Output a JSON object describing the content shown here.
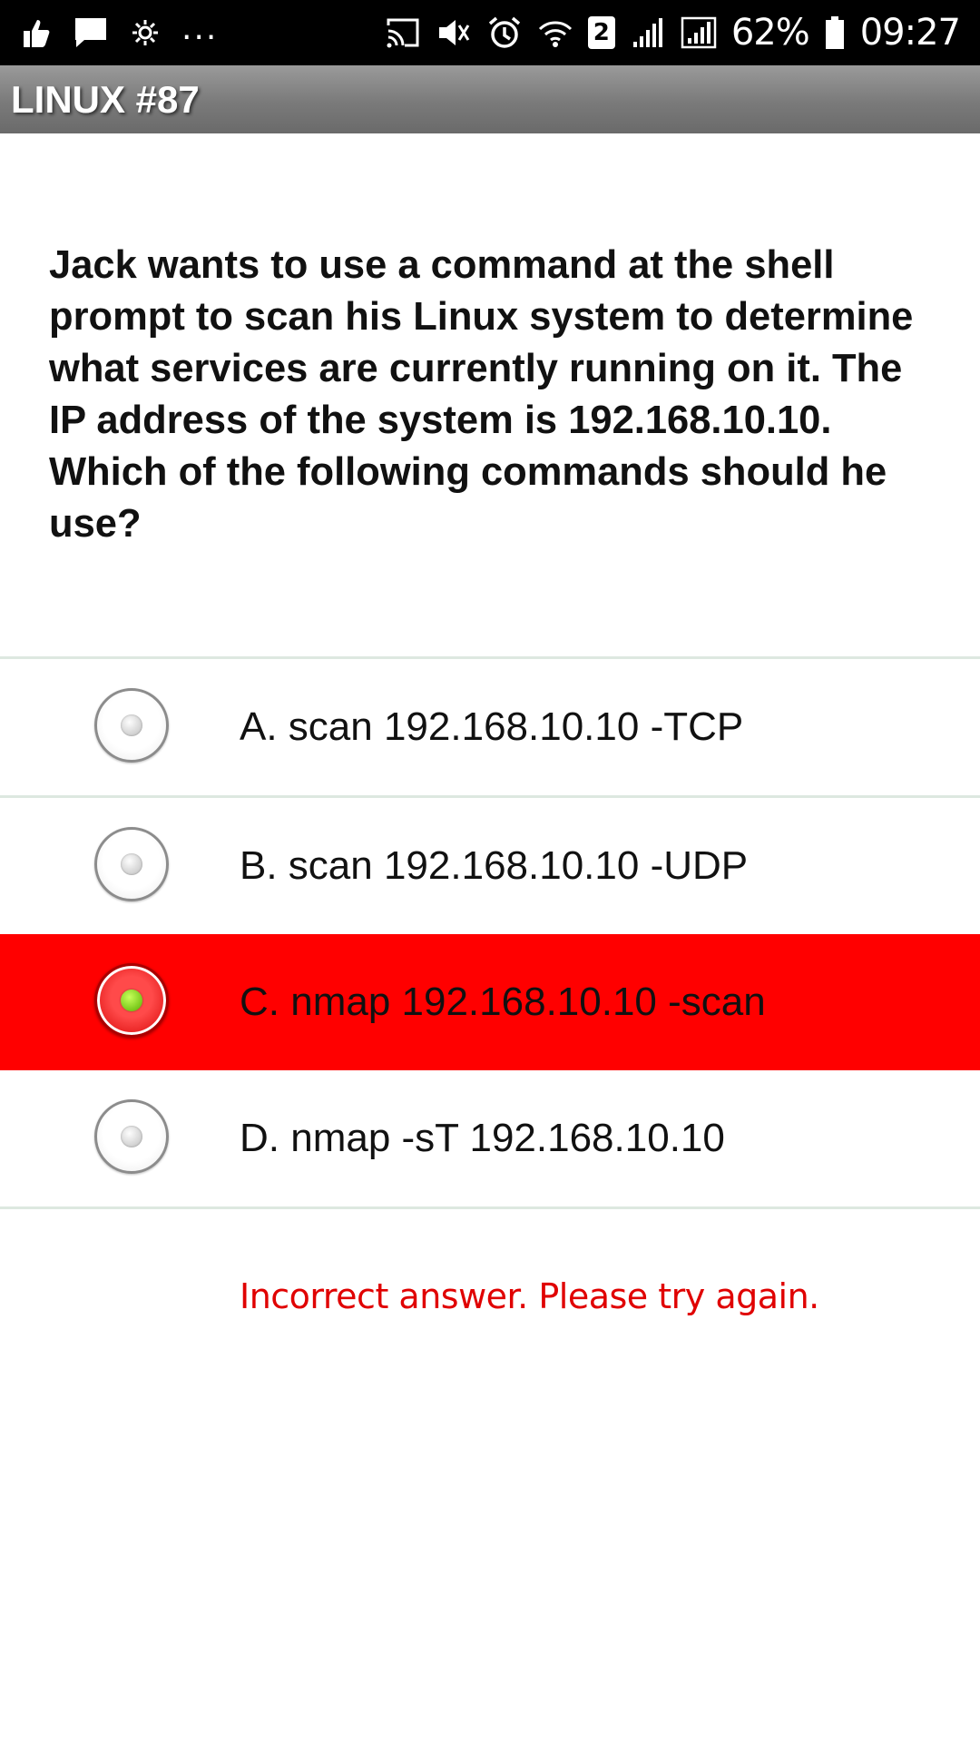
{
  "status_bar": {
    "left_icons": [
      "thumbs-up-icon",
      "chat-bubble-icon",
      "blossom-icon",
      "more-notifications-icon"
    ],
    "ellipsis": "...",
    "sim_badge": "2",
    "battery": "62%",
    "time": "09:27",
    "right_icons": [
      "cast-icon",
      "mute-icon",
      "alarm-icon",
      "wifi-icon",
      "signal-icon",
      "signal-icon",
      "battery-icon"
    ]
  },
  "header": {
    "title": "LINUX #87"
  },
  "quiz": {
    "question": "Jack wants to use a command at the shell prompt to scan his Linux system to determine what services are currently running on it. The IP address of the system is 192.168.10.10. Which of the following commands should he use?",
    "options": [
      {
        "label": "A. scan 192.168.10.10 -TCP",
        "selected": false
      },
      {
        "label": "B. scan 192.168.10.10 -UDP",
        "selected": false
      },
      {
        "label": "C. nmap 192.168.10.10 -scan",
        "selected": true
      },
      {
        "label": "D. nmap -sT 192.168.10.10",
        "selected": false
      }
    ],
    "feedback": "Incorrect answer. Please try again."
  },
  "colors": {
    "selected_background": "#ff0000",
    "feedback_text": "#e00000",
    "selected_dot": "#78c81a"
  }
}
